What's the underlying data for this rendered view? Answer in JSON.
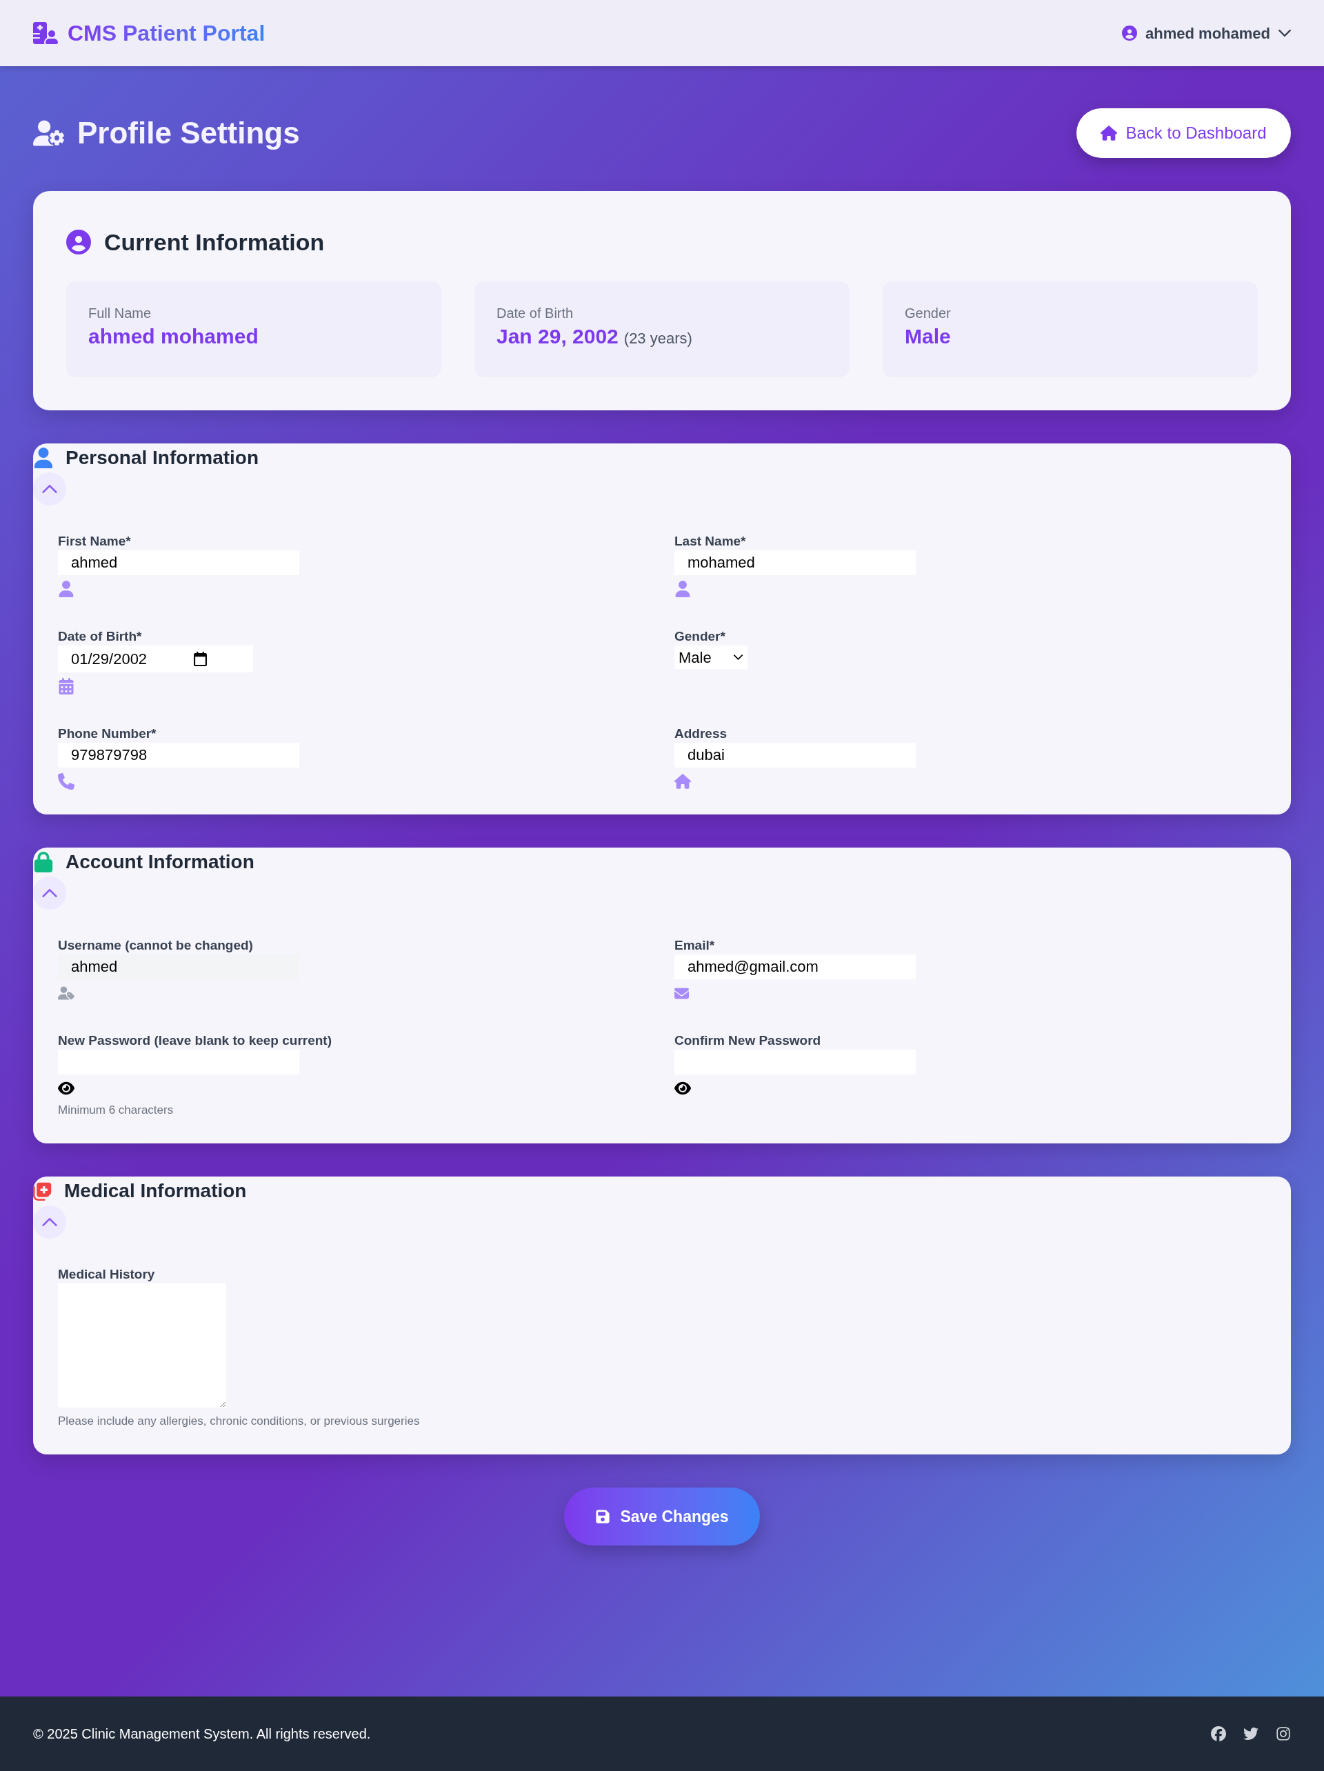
{
  "header": {
    "brand": "CMS Patient Portal",
    "user_name": "ahmed mohamed"
  },
  "page_header": {
    "title": "Profile Settings",
    "back_button": "Back to Dashboard"
  },
  "current_information": {
    "title": "Current Information",
    "items": [
      {
        "label": "Full Name",
        "value": "ahmed mohamed"
      },
      {
        "label": "Date of Birth",
        "value": "Jan 29, 2002",
        "note": "(23 years)"
      },
      {
        "label": "Gender",
        "value": "Male"
      }
    ]
  },
  "personal_information": {
    "title": "Personal Information",
    "expanded": true,
    "fields": [
      {
        "kind": "name",
        "label": "First Name*",
        "value": "ahmed",
        "disabled": false
      },
      {
        "kind": "name",
        "label": "Last Name*",
        "value": "mohamed",
        "disabled": false
      },
      {
        "kind": "date",
        "label": "Date of Birth*",
        "value": "01/29/2002",
        "disabled": false
      },
      {
        "kind": "gender",
        "label": "Gender*",
        "value": "Male",
        "disabled": false
      },
      {
        "kind": "phone",
        "label": "Phone Number*",
        "value": "979879798",
        "disabled": false
      },
      {
        "kind": "address",
        "label": "Address",
        "value": "dubai",
        "disabled": false
      }
    ]
  },
  "account_information": {
    "title": "Account Information",
    "expanded": true,
    "fields": [
      {
        "kind": "username",
        "label": "Username (cannot be changed)",
        "value": "ahmed",
        "disabled": true
      },
      {
        "kind": "email",
        "label": "Email*",
        "value": "ahmed@gmail.com",
        "disabled": false
      },
      {
        "kind": "password",
        "label": "New Password (leave blank to keep current)",
        "hint": "Minimum 6 characters",
        "disabled": false
      },
      {
        "kind": "password",
        "label": "Confirm New Password",
        "disabled": false
      }
    ]
  },
  "medical_information": {
    "title": "Medical Information",
    "expanded": true,
    "fields": [
      {
        "kind": "history",
        "label": "Medical History",
        "hint": "Please include any allergies, chronic conditions, or previous surgeries",
        "disabled": false
      }
    ]
  },
  "save_button": "Save Changes",
  "footer": {
    "copyright": "© 2025 Clinic Management System. All rights reserved."
  }
}
